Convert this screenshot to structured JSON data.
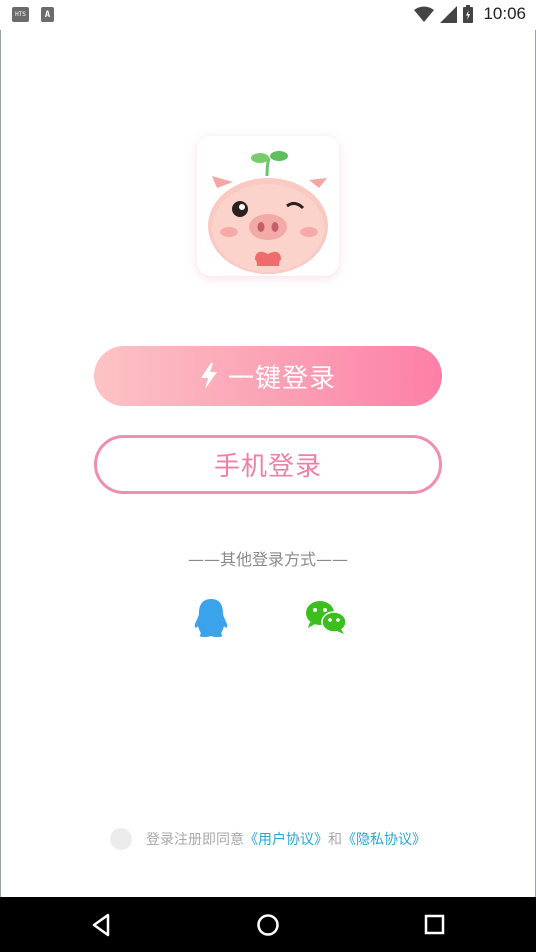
{
  "status_bar": {
    "left_badges": [
      "HTS",
      "A"
    ],
    "time": "10:06",
    "icons": [
      "wifi-icon",
      "signal-icon",
      "battery-icon"
    ]
  },
  "logo": {
    "icon": "pig-mascot-logo"
  },
  "buttons": {
    "one_key_login": "一键登录",
    "one_key_icon": "lightning-icon",
    "phone_login": "手机登录"
  },
  "other_login": {
    "title": "——其他登录方式——",
    "providers": [
      "qq-icon",
      "wechat-icon"
    ]
  },
  "agreement": {
    "prefix": "登录注册即同意",
    "user_agreement": "《用户协议》",
    "and": "和",
    "privacy_policy": "《隐私协议》"
  },
  "colors": {
    "gradient_start": "#fdc3c4",
    "gradient_end": "#fd7fa7",
    "phone_border": "#f08eae",
    "link": "#27a8d6",
    "qq": "#3ba3ea",
    "wechat": "#3bbf1d"
  },
  "nav_bar": {
    "buttons": [
      "back-icon",
      "home-icon",
      "recents-icon"
    ]
  }
}
